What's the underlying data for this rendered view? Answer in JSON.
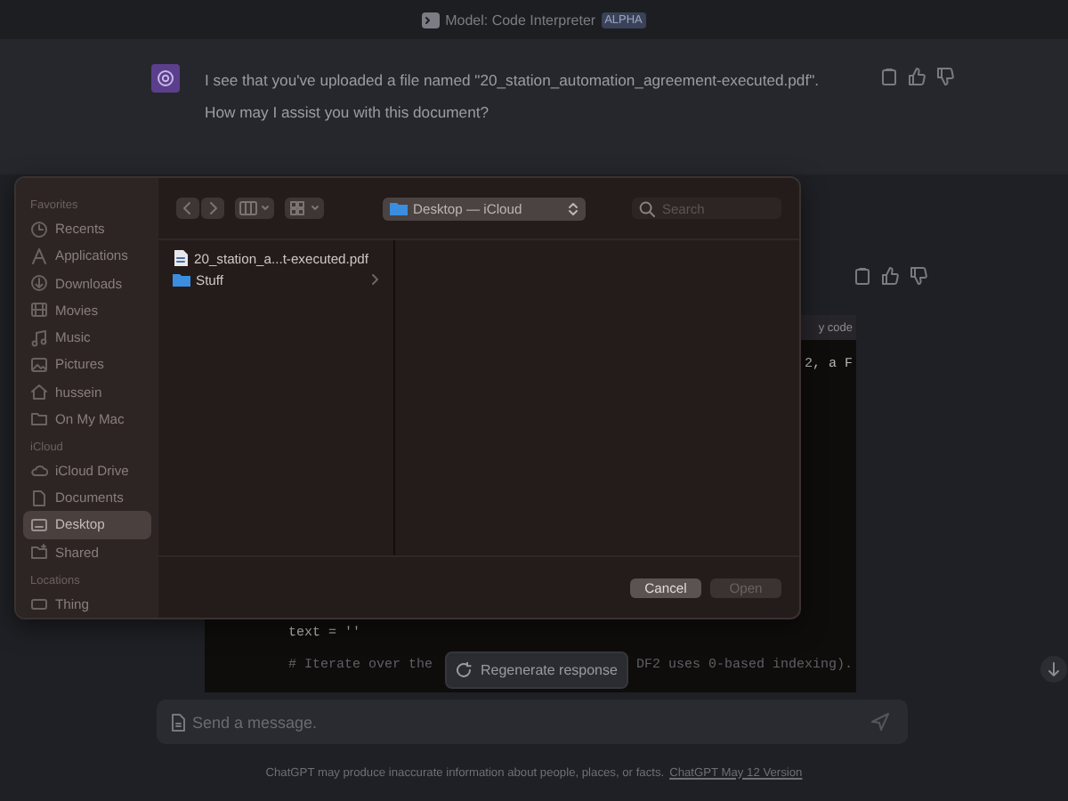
{
  "header": {
    "model_label": "Model: Code Interpreter",
    "badge": "ALPHA"
  },
  "message": {
    "text": "I see that you've uploaded a file named \"20_station_automation_agreement-executed.pdf\". How may I assist you with this document?"
  },
  "code_block": {
    "caption_fragment": "y code",
    "line_fragment": "2, a F",
    "assignment_line": "text = ''",
    "comment_start": "# Iterate over the",
    "comment_end": "DF2 uses 0-based indexing)."
  },
  "regenerate_button": "Regenerate response",
  "composer": {
    "placeholder": "Send a message."
  },
  "disclaimer": {
    "text": "ChatGPT may produce inaccurate information about people, places, or facts.",
    "link": "ChatGPT May 12 Version"
  },
  "dialog": {
    "sidebar": [
      {
        "heading": "Favorites",
        "items": [
          {
            "label": "Recents",
            "selected": false
          },
          {
            "label": "Applications",
            "selected": false
          },
          {
            "label": "Downloads",
            "selected": false
          },
          {
            "label": "Movies",
            "selected": false
          },
          {
            "label": "Music",
            "selected": false
          },
          {
            "label": "Pictures",
            "selected": false
          },
          {
            "label": "hussein",
            "selected": false
          },
          {
            "label": "On My Mac",
            "selected": false
          }
        ]
      },
      {
        "heading": "iCloud",
        "items": [
          {
            "label": "iCloud Drive",
            "selected": false
          },
          {
            "label": "Documents",
            "selected": false
          },
          {
            "label": "Desktop",
            "selected": true
          },
          {
            "label": "Shared",
            "selected": false
          }
        ]
      },
      {
        "heading": "Locations",
        "items": [
          {
            "label": "Thing",
            "selected": false
          }
        ]
      }
    ],
    "location": "Desktop — iCloud",
    "search": {
      "placeholder": "Search"
    },
    "files": [
      {
        "name": "20_station_a...t-executed.pdf",
        "kind": "document"
      },
      {
        "name": "Stuff",
        "kind": "folder"
      }
    ],
    "buttons": [
      {
        "label": "Cancel",
        "disabled": false
      },
      {
        "label": "Open",
        "disabled": true
      }
    ]
  }
}
